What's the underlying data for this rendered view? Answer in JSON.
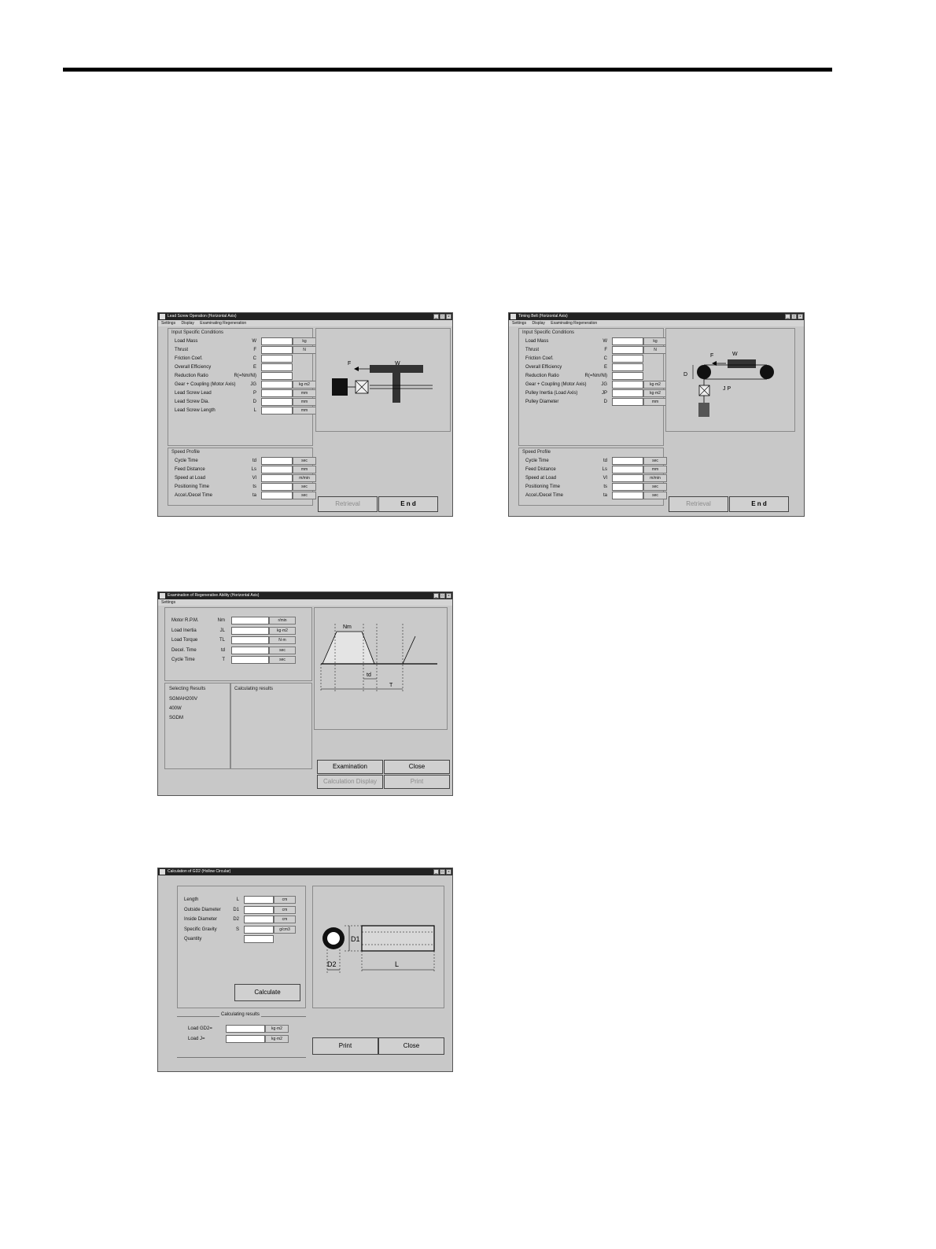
{
  "window1": {
    "title": "Lead Screw Operation (Horizontal Axis)",
    "menu": [
      "Settings",
      "Display",
      "Examinating Regeneration"
    ],
    "input_group": "Input Specific Conditions",
    "input_rows": [
      {
        "label": "Load Mass",
        "symbol": "W",
        "unit": "kg"
      },
      {
        "label": "Thrust",
        "symbol": "F",
        "unit": "N"
      },
      {
        "label": "Friction Coef.",
        "symbol": "C",
        "unit": ""
      },
      {
        "label": "Overall Efficiency",
        "symbol": "E",
        "unit": ""
      },
      {
        "label": "Reduction Ratio",
        "symbol": "R(=Nm/Nl)",
        "unit": ""
      },
      {
        "label": "Gear + Coupling (Motor Axis)",
        "symbol": "JG",
        "unit": "kg·m2"
      },
      {
        "label": "Lead Screw Lead",
        "symbol": "P",
        "unit": "mm"
      },
      {
        "label": "Lead Screw Dia.",
        "symbol": "D",
        "unit": "mm"
      },
      {
        "label": "Lead Screw Length",
        "symbol": "L",
        "unit": "mm"
      }
    ],
    "speed_group": "Speed Profile",
    "speed_rows": [
      {
        "label": "Cycle Time",
        "symbol": "td",
        "unit": "sec"
      },
      {
        "label": "Feed Distance",
        "symbol": "Ls",
        "unit": "mm"
      },
      {
        "label": "Speed at Load",
        "symbol": "Vl",
        "unit": "m/min"
      },
      {
        "label": "Positioning Time",
        "symbol": "ts",
        "unit": "sec"
      },
      {
        "label": "Accel./Decel Time",
        "symbol": "ta",
        "unit": "sec"
      }
    ],
    "diagram": {
      "f": "F",
      "w": "W"
    },
    "buttons": {
      "retrieval": "Retrieval",
      "end": "E n d"
    }
  },
  "window2": {
    "title": "Timing Belt (Horizontal Axis)",
    "menu": [
      "Settings",
      "Display",
      "Examinating Regeneration"
    ],
    "input_group": "Input Specific Conditions",
    "input_rows": [
      {
        "label": "Load Mass",
        "symbol": "W",
        "unit": "kg"
      },
      {
        "label": "Thrust",
        "symbol": "F",
        "unit": "N"
      },
      {
        "label": "Friction Coef.",
        "symbol": "C",
        "unit": ""
      },
      {
        "label": "Overall Efficiency",
        "symbol": "E",
        "unit": ""
      },
      {
        "label": "Reduction Ratio",
        "symbol": "R(=Nm/Nl)",
        "unit": ""
      },
      {
        "label": "Gear + Coupling (Motor Axis)",
        "symbol": "JG",
        "unit": "kg·m2"
      },
      {
        "label": "Pulley Inertia (Load Axis)",
        "symbol": "JP",
        "unit": "kg·m2"
      },
      {
        "label": "Pulley Diameter",
        "symbol": "D",
        "unit": "mm"
      }
    ],
    "speed_group": "Speed Profile",
    "speed_rows": [
      {
        "label": "Cycle Time",
        "symbol": "td",
        "unit": "sec"
      },
      {
        "label": "Feed Distance",
        "symbol": "Ls",
        "unit": "mm"
      },
      {
        "label": "Speed at Load",
        "symbol": "Vl",
        "unit": "m/min"
      },
      {
        "label": "Positioning Time",
        "symbol": "ts",
        "unit": "sec"
      },
      {
        "label": "Accel./Decel Time",
        "symbol": "ta",
        "unit": "sec"
      }
    ],
    "diagram": {
      "f": "F",
      "w": "W",
      "d": "D",
      "jp": "J P"
    },
    "buttons": {
      "retrieval": "Retrieval",
      "end": "E n d"
    }
  },
  "window3": {
    "title": "Examination of Regenerative Ability (Horizontal Axis)",
    "menu": [
      "Settings"
    ],
    "rows": [
      {
        "label": "Motor R.P.M.",
        "symbol": "Nm",
        "unit": "r/min"
      },
      {
        "label": "Load Inertia",
        "symbol": "JL",
        "unit": "kg·m2"
      },
      {
        "label": "Load Torque",
        "symbol": "TL",
        "unit": "N·m"
      },
      {
        "label": "Decel. Time",
        "symbol": "td",
        "unit": "sec"
      },
      {
        "label": "Cycle Time",
        "symbol": "T",
        "unit": "sec"
      }
    ],
    "selecting_title": "Selecting Results",
    "selecting_lines": [
      "SGMAH200V",
      "400W",
      "SGDM"
    ],
    "calculating_title": "Calculating results",
    "graph": {
      "nm": "Nm",
      "td": "td",
      "t": "T"
    },
    "buttons": {
      "examination": "Examination",
      "close": "Close",
      "calc_display": "Calculation Display",
      "print": "Print"
    }
  },
  "window4": {
    "title": "Calculation of GD2 (Hollow Circular)",
    "rows": [
      {
        "label": "Length",
        "symbol": "L",
        "unit": "cm"
      },
      {
        "label": "Outside Diameter",
        "symbol": "D1",
        "unit": "cm"
      },
      {
        "label": "Inside Diameter",
        "symbol": "D2",
        "unit": "cm"
      },
      {
        "label": "Specific Gravity",
        "symbol": "S",
        "unit": "g/cm3"
      },
      {
        "label": "Quantity",
        "symbol": "",
        "unit": ""
      }
    ],
    "calculate": "Calculate",
    "results_title": "Calculating results",
    "results": [
      {
        "label": "Load  GD2=",
        "unit": "kg·m2"
      },
      {
        "label": "Load    J=",
        "unit": "kg·m2"
      }
    ],
    "diagram": {
      "d1": "D1",
      "d2": "D2",
      "l": "L"
    },
    "buttons": {
      "print": "Print",
      "close": "Close"
    }
  }
}
